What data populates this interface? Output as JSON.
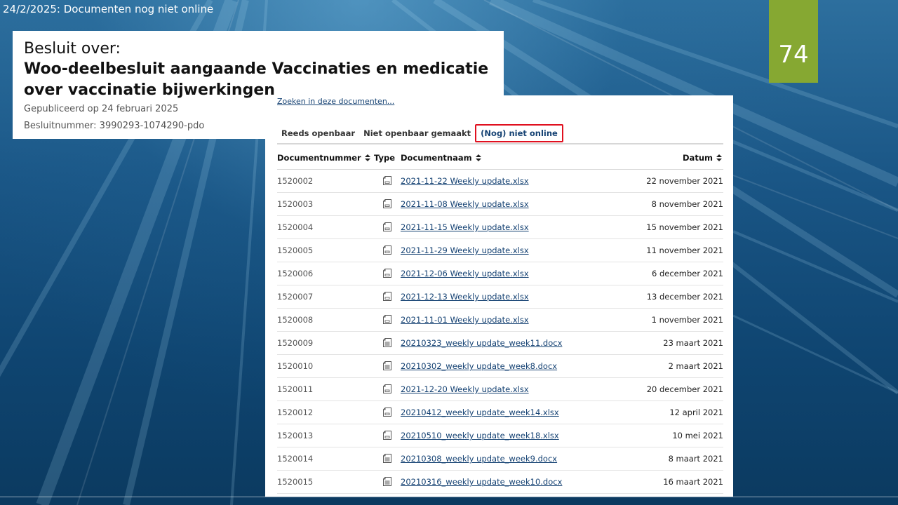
{
  "slide": {
    "title": "24/2/2025: Documenten nog niet online",
    "page_number": "74"
  },
  "besluit": {
    "label": "Besluit over:",
    "heading": "Woo-deelbesluit aangaande Vaccinaties en medicatie over vaccinatie bijwerkingen",
    "published": "Gepubliceerd op 24 februari 2025",
    "besluitnummer": "Besluitnummer: 3990293-1074290-pdo"
  },
  "documents": {
    "search_link": "Zoeken in deze documenten...",
    "tabs": [
      {
        "label": "Reeds openbaar",
        "active": false
      },
      {
        "label": "Niet openbaar gemaakt",
        "active": false
      },
      {
        "label": "(Nog) niet online",
        "active": true
      }
    ],
    "columns": {
      "number": "Documentnummer",
      "type": "Type",
      "name": "Documentnaam",
      "date": "Datum"
    },
    "rows": [
      {
        "number": "1520002",
        "name": "2021-11-22 Weekly update.xlsx",
        "date": "22 november 2021",
        "icon": "spreadsheet-icon"
      },
      {
        "number": "1520003",
        "name": "2021-11-08 Weekly update.xlsx",
        "date": "8 november 2021",
        "icon": "spreadsheet-icon"
      },
      {
        "number": "1520004",
        "name": "2021-11-15 Weekly update.xlsx",
        "date": "15 november 2021",
        "icon": "spreadsheet-icon"
      },
      {
        "number": "1520005",
        "name": "2021-11-29 Weekly update.xlsx",
        "date": "11 november 2021",
        "icon": "spreadsheet-icon"
      },
      {
        "number": "1520006",
        "name": "2021-12-06 Weekly update.xlsx",
        "date": "6 december 2021",
        "icon": "spreadsheet-icon"
      },
      {
        "number": "1520007",
        "name": "2021-12-13 Weekly update.xlsx",
        "date": "13 december 2021",
        "icon": "spreadsheet-icon"
      },
      {
        "number": "1520008",
        "name": "2021-11-01 Weekly update.xlsx",
        "date": "1 november 2021",
        "icon": "spreadsheet-icon"
      },
      {
        "number": "1520009",
        "name": "20210323_weekly update_week11.docx",
        "date": "23 maart 2021",
        "icon": "document-icon"
      },
      {
        "number": "1520010",
        "name": "20210302_weekly update_week8.docx",
        "date": "2 maart 2021",
        "icon": "document-icon"
      },
      {
        "number": "1520011",
        "name": "2021-12-20 Weekly update.xlsx",
        "date": "20 december 2021",
        "icon": "spreadsheet-icon"
      },
      {
        "number": "1520012",
        "name": "20210412_weekly update_week14.xlsx",
        "date": "12 april 2021",
        "icon": "spreadsheet-icon"
      },
      {
        "number": "1520013",
        "name": "20210510_weekly update_week18.xlsx",
        "date": "10 mei 2021",
        "icon": "spreadsheet-icon"
      },
      {
        "number": "1520014",
        "name": "20210308_weekly update_week9.docx",
        "date": "8 maart 2021",
        "icon": "document-icon"
      },
      {
        "number": "1520015",
        "name": "20210316_weekly update_week10.docx",
        "date": "16 maart 2021",
        "icon": "document-icon"
      }
    ]
  },
  "colors": {
    "accent_green": "#86a832",
    "link_blue": "#154273",
    "highlight_red": "#e0101f"
  }
}
